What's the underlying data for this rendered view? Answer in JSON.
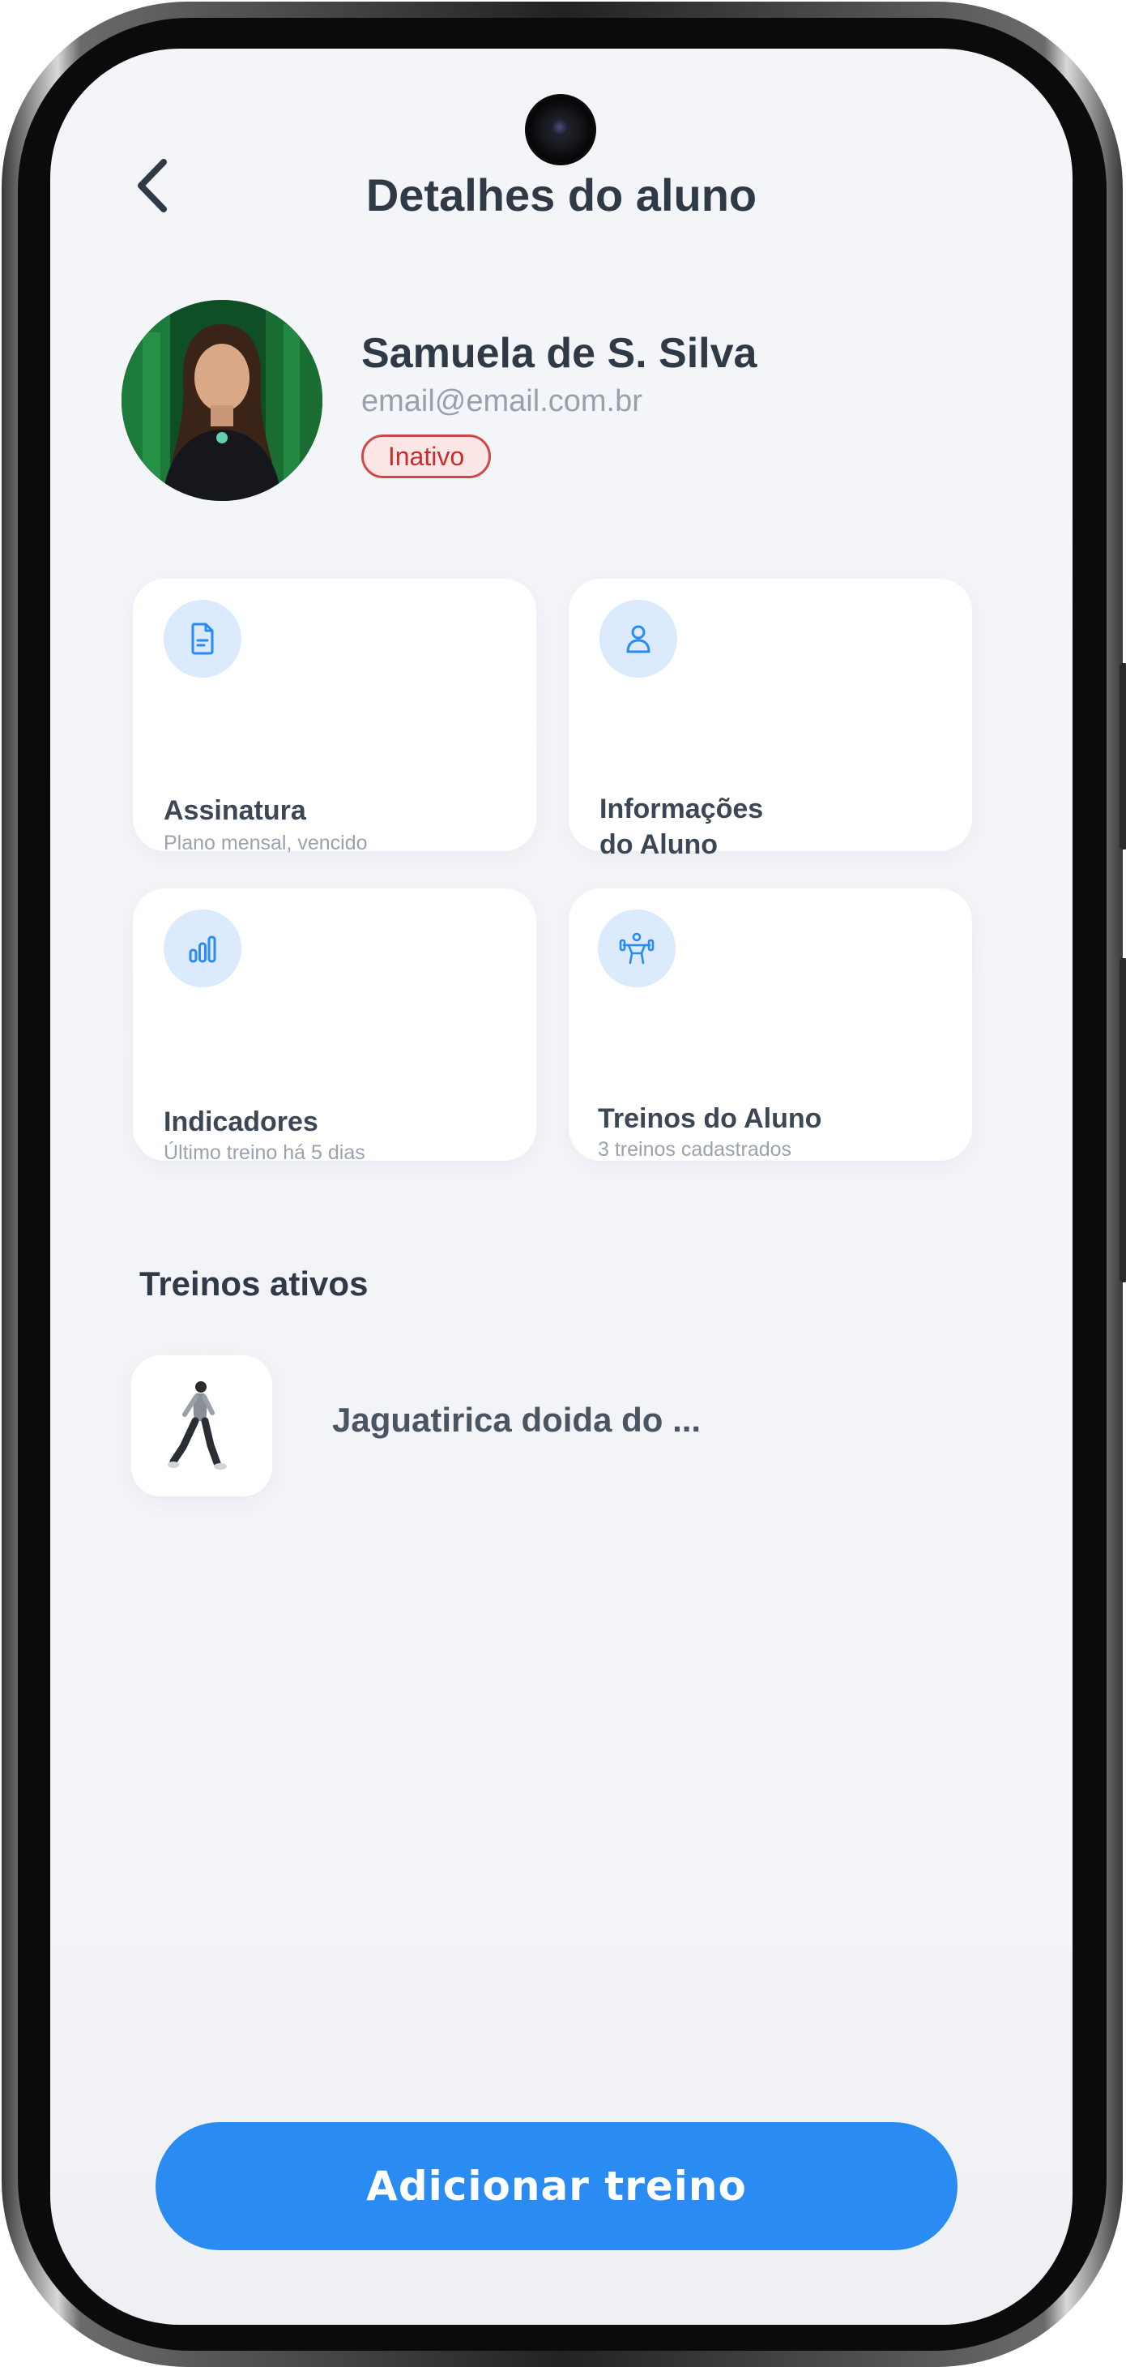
{
  "header": {
    "title": "Detalhes do aluno",
    "back_icon": "chevron-left-icon"
  },
  "profile": {
    "name": "Samuela de S. Silva",
    "email": "email@email.com.br",
    "status": "Inativo",
    "status_color": "#d04848"
  },
  "cards": [
    {
      "title": "Assinatura",
      "subtitle": "Plano mensal, vencido",
      "icon": "document-icon"
    },
    {
      "title_line1": "Informações",
      "title_line2": "do Aluno",
      "icon": "user-icon"
    },
    {
      "title": "Indicadores",
      "subtitle": "Último treino há 5 dias",
      "icon": "bar-chart-icon"
    },
    {
      "title": "Treinos do Aluno",
      "subtitle": "3 treinos cadastrados",
      "icon": "dumbbell-icon"
    }
  ],
  "active_workouts": {
    "title": "Treinos ativos",
    "items": [
      {
        "name": "Jaguatirica doida do ...",
        "thumb_icon": "runner-icon"
      }
    ]
  },
  "action": {
    "label": "Adicionar treino",
    "color": "#2a8bf2"
  },
  "colors": {
    "background": "#f4f5f9",
    "card": "#ffffff",
    "icon_circle": "#dbeafd",
    "icon_stroke": "#2a8bf2",
    "text_primary": "#2f3a46"
  }
}
